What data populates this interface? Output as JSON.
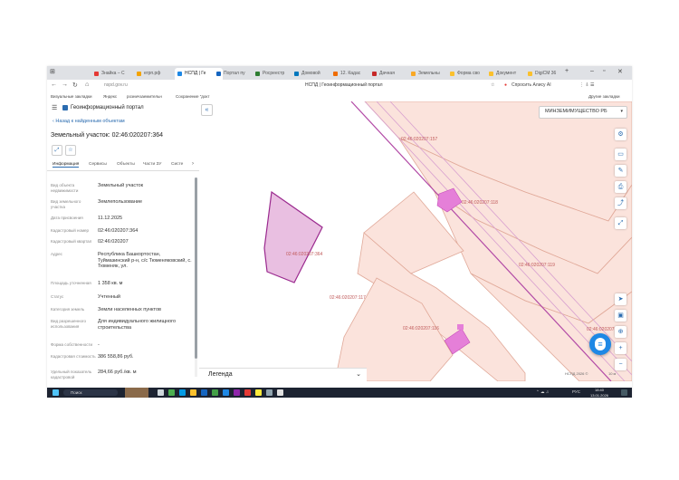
{
  "browser": {
    "tabs": [
      {
        "label": "Знайка – С"
      },
      {
        "label": "егрп.рф"
      },
      {
        "label": "НСПД | Ге",
        "active": true
      },
      {
        "label": "Портал пу"
      },
      {
        "label": "Росреестр"
      },
      {
        "label": "Домовой"
      },
      {
        "label": "12. Кадас"
      },
      {
        "label": "Дачная"
      },
      {
        "label": "Земельны"
      },
      {
        "label": "Форма сво"
      },
      {
        "label": "Документ"
      },
      {
        "label": "DigiCM 36"
      }
    ],
    "url": "nspd.gov.ru",
    "page_title": "НСПД | Геоинформационный портал",
    "search_ext": "Спросить Алису AI",
    "bookmarks": [
      "Визуальные закладки",
      "Яндекс",
      "розничзаемительн",
      "Сохранение \"докт"
    ],
    "other_bookmarks": "Другие закладки"
  },
  "app": {
    "title": "Геоинформационный портал",
    "back_link": "Назад к найденным объектам",
    "object_title": "Земельный участок: 02:46:020207:364",
    "tabs": [
      "Информация",
      "Сервисы",
      "Объекты",
      "Части ЗУ",
      "Систе"
    ],
    "dropdown": "МИНЗЕМИМУЩЕСТВО РБ",
    "legend": "Легенда",
    "fields": [
      {
        "label": "Вид объекта недвижимости",
        "value": "Земельный участок"
      },
      {
        "label": "Вид земельного участка",
        "value": "Землепользование"
      },
      {
        "label": "Дата присвоения",
        "value": "11.12.2025"
      },
      {
        "label": "Кадастровый номер",
        "value": "02:46:020207:364"
      },
      {
        "label": "Кадастровый квартал",
        "value": "02:46:020207"
      },
      {
        "label": "Адрес",
        "value": "Республика Башкортостан, Туймазинский р-н, с/с Тюменяковский, с. Тюменяк, ул."
      },
      {
        "label": "Площадь уточненная",
        "value": "1 358 кв. м"
      },
      {
        "label": "Статус",
        "value": "Учтенный"
      },
      {
        "label": "Категория земель",
        "value": "Земли населенных пунктов"
      },
      {
        "label": "Вид разрешенного использования",
        "value": "Для индивидуального жилищного строительства"
      },
      {
        "label": "Форма собственности",
        "value": "-"
      },
      {
        "label": "Кадастровая стоимость",
        "value": "386 558,86 руб."
      },
      {
        "label": "Удельный показатель кадастровой",
        "value": "284,66 руб./кв. м"
      }
    ]
  },
  "map": {
    "parcels": [
      {
        "id": "02:46:020207:157"
      },
      {
        "id": "02:46:020207:118"
      },
      {
        "id": "02:46:020207:364",
        "selected": true
      },
      {
        "id": "02:46:020207:117"
      },
      {
        "id": "02:46:020207:119"
      },
      {
        "id": "02:46:020207:116"
      },
      {
        "id": "02:46:020207:109"
      }
    ],
    "scale": "НСПД 2026 ©",
    "scale_value": "10 м"
  },
  "taskbar": {
    "search": "Поиск",
    "time": "18:40",
    "date": "13.01.2026",
    "lang": "РУС"
  },
  "colors": {
    "parcel_fill": "#fbe3dc",
    "parcel_stroke": "#e0a898",
    "selected_fill": "#e9bfe1",
    "selected_stroke": "#9b2a8f",
    "building": "#e57fd8",
    "road_line": "#b24aa6",
    "accent": "#2b6cb0",
    "fab": "#1e88e5"
  }
}
